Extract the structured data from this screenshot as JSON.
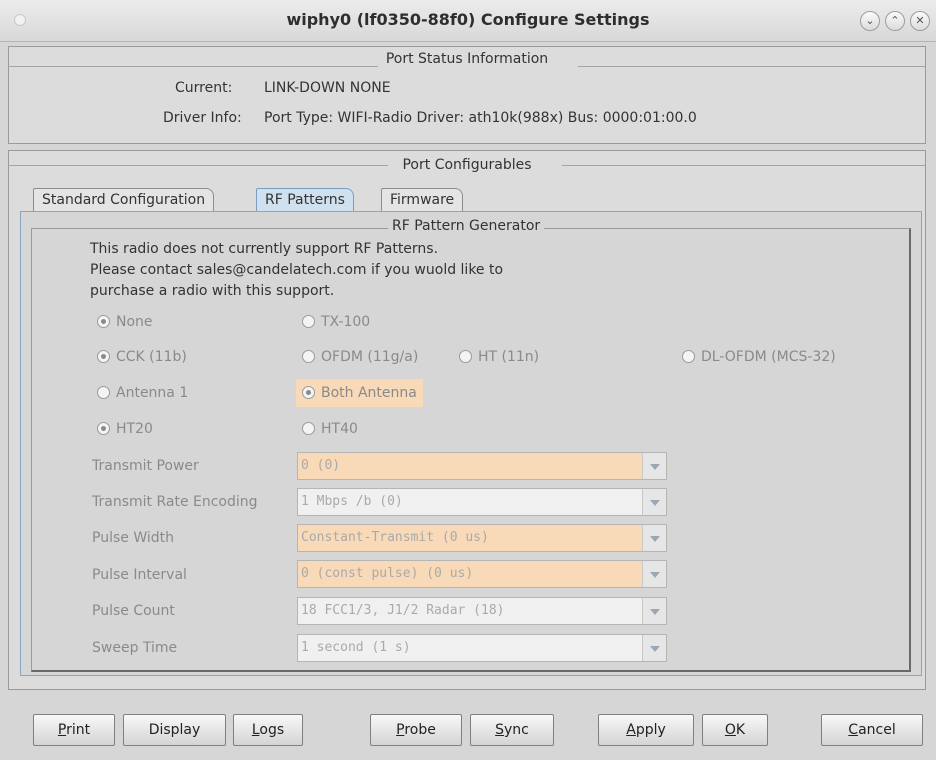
{
  "window": {
    "title": "wiphy0  (lf0350-88f0) Configure Settings"
  },
  "status": {
    "title": "Port Status Information",
    "current_label": "Current:",
    "current_value": "LINK-DOWN  NONE",
    "driver_label": "Driver Info:",
    "driver_value": "Port Type: WIFI-Radio   Driver: ath10k(988x)  Bus: 0000:01:00.0"
  },
  "config": {
    "title": "Port Configurables",
    "tabs": [
      {
        "label": "Standard Configuration",
        "active": false
      },
      {
        "label": "RF Patterns",
        "active": true
      },
      {
        "label": "Firmware",
        "active": false
      }
    ]
  },
  "rf": {
    "title": "RF Pattern Generator",
    "message": [
      "This radio does not currently support RF Patterns.",
      "Please contact sales@candelatech.com if you wuold like to",
      "purchase a radio with this support."
    ],
    "radios": {
      "none": {
        "label": "None",
        "checked": true
      },
      "tx100": {
        "label": "TX-100",
        "checked": false
      },
      "cck": {
        "label": "CCK (11b)",
        "checked": true
      },
      "ofdm": {
        "label": "OFDM (11g/a)",
        "checked": false
      },
      "ht": {
        "label": "HT (11n)",
        "checked": false
      },
      "dlofdm": {
        "label": "DL-OFDM (MCS-32)",
        "checked": false
      },
      "ant1": {
        "label": "Antenna 1",
        "checked": false
      },
      "both": {
        "label": "Both Antenna",
        "checked": true
      },
      "ht20": {
        "label": "HT20",
        "checked": true
      },
      "ht40": {
        "label": "HT40",
        "checked": false
      }
    },
    "fields": [
      {
        "label": "Transmit Power",
        "value": "0 (0)"
      },
      {
        "label": "Transmit Rate Encoding",
        "value": "1 Mbps /b  (0)"
      },
      {
        "label": "Pulse Width",
        "value": "Constant-Transmit (0 us)"
      },
      {
        "label": "Pulse Interval",
        "value": "0 (const pulse) (0 us)"
      },
      {
        "label": "Pulse Count",
        "value": "18 FCC1/3, J1/2 Radar (18)"
      },
      {
        "label": "Sweep Time",
        "value": "1 second (1 s)"
      }
    ]
  },
  "buttons": {
    "print": {
      "mnemonic": "P",
      "rest": "rint"
    },
    "display": {
      "label": "Display"
    },
    "logs": {
      "mnemonic": "L",
      "rest": "ogs"
    },
    "probe": {
      "mnemonic": "P",
      "rest": "robe"
    },
    "sync": {
      "mnemonic": "S",
      "rest": "ync"
    },
    "apply": {
      "mnemonic": "A",
      "rest": "pply"
    },
    "ok": {
      "mnemonic": "O",
      "rest": "K"
    },
    "cancel": {
      "mnemonic": "C",
      "rest": "ancel"
    }
  },
  "colors": {
    "highlight": "#f8d9b8",
    "active_tab": "#cfe0ef",
    "window_bg": "#d6d6d6"
  }
}
